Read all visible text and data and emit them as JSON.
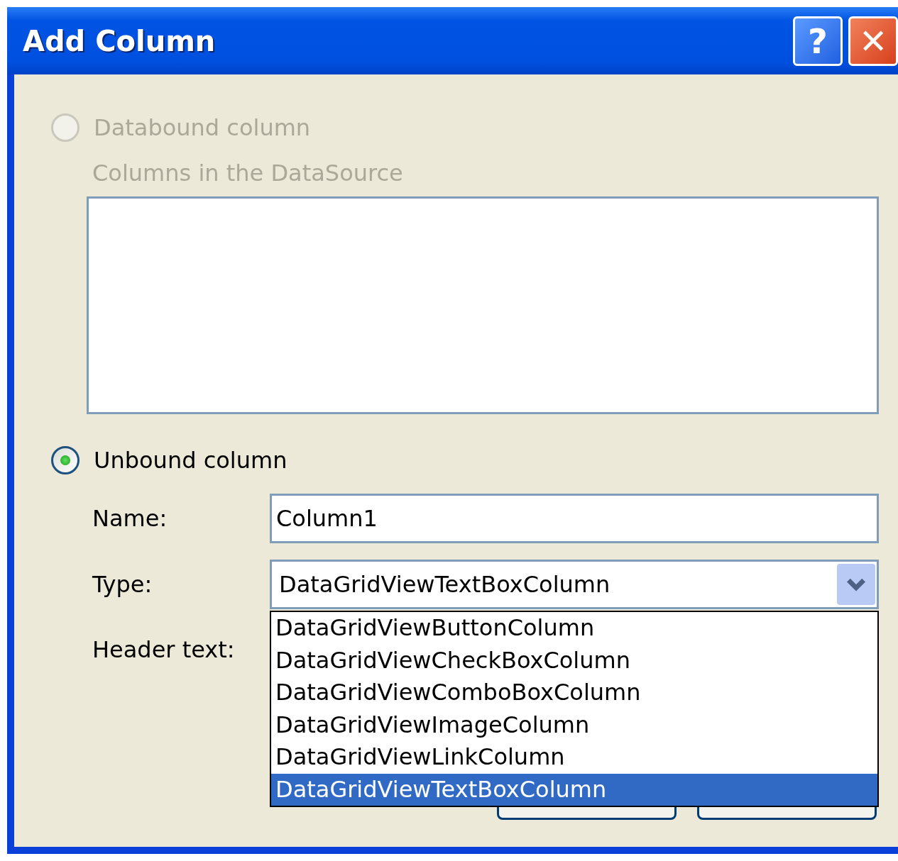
{
  "window": {
    "title": "Add Column",
    "buttons": [
      {
        "kind": "help",
        "label": "?"
      },
      {
        "kind": "close",
        "label": "✕"
      }
    ]
  },
  "databound": {
    "label": "Databound column",
    "selected": false,
    "disabled": true,
    "list_label": "Columns in the DataSource"
  },
  "unbound": {
    "label": "Unbound column",
    "selected": true,
    "disabled": false
  },
  "name_field": {
    "label": "Name:",
    "value": "Column1"
  },
  "type_field": {
    "label": "Type:",
    "value": "DataGridViewTextBoxColumn",
    "expanded": true,
    "options": [
      {
        "label": "DataGridViewButtonColumn",
        "selected": false
      },
      {
        "label": "DataGridViewCheckBoxColumn",
        "selected": false
      },
      {
        "label": "DataGridViewComboBoxColumn",
        "selected": false
      },
      {
        "label": "DataGridViewImageColumn",
        "selected": false
      },
      {
        "label": "DataGridViewLinkColumn",
        "selected": false
      },
      {
        "label": "DataGridViewTextBoxColumn",
        "selected": true
      }
    ]
  },
  "header_field": {
    "label": "Header text:"
  }
}
